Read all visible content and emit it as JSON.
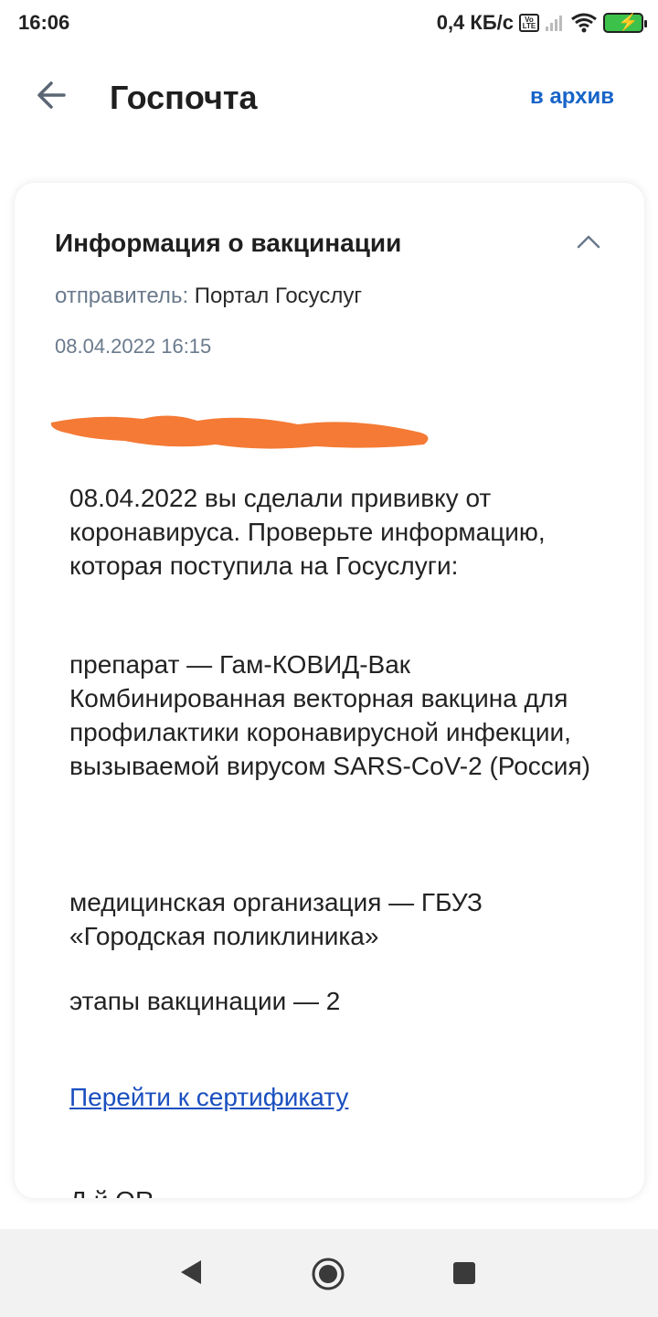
{
  "status_bar": {
    "time": "16:06",
    "speed": "0,4 КБ/с",
    "volte_top": "Vo",
    "volte_bottom": "LTE",
    "battery_color": "#3cc24b"
  },
  "header": {
    "title": "Госпочта",
    "archive_label": "в архив",
    "back_icon": "arrow-left-icon"
  },
  "message": {
    "title": "Информация о вакцинации",
    "sender_label": "отправитель:",
    "sender_name": "Портал Госуслуг",
    "date": "08.04.2022 16:15",
    "paragraph_1": "08.04.2022 вы сделали прививку от коронавируса. Проверьте информацию, которая поступила на Госуслуги:",
    "paragraph_2": "препарат — Гам-КОВИД-Вак Комбинированная векторная вакцина для профилактики коронавирусной инфекции, вызываемой вирусом SARS-CoV-2 (Россия)",
    "paragraph_3": "медицинская организация — ГБУЗ «Городская поликлиника»",
    "paragraph_4": "этапы вакцинации — 2",
    "certificate_link": "Перейти к сертификату",
    "cut_text": "Д                                      й             QR"
  },
  "colors": {
    "accent": "#1764c8",
    "link": "#1a4fbf",
    "muted": "#6a7a8c",
    "redaction": "#f47a35"
  }
}
